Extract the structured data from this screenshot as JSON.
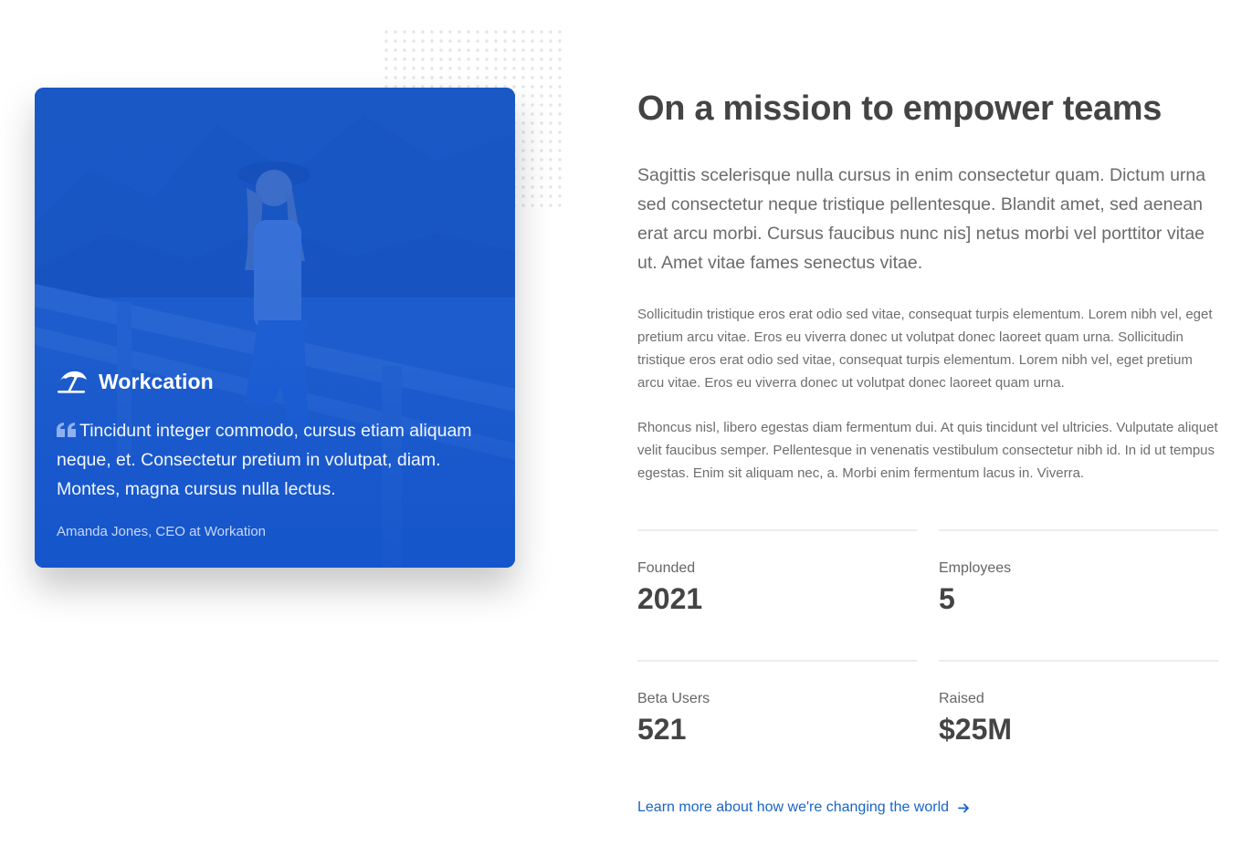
{
  "colors": {
    "accent": "#1a64c8",
    "card_overlay": "#155ad6",
    "heading": "#444444",
    "body_text": "#6b6b6b"
  },
  "card": {
    "brand_icon": "beach-umbrella-icon",
    "brand_name": "Workcation",
    "quote_icon": "quote-icon",
    "quote": "Tincidunt integer commodo, cursus etiam aliquam neque, et. Consectetur pretium in volutpat, diam. Montes, magna cursus nulla lectus.",
    "author": "Amanda Jones, CEO at Workation"
  },
  "content": {
    "heading": "On a mission to empower teams",
    "lead": "Sagittis scelerisque nulla cursus in enim consectetur quam. Dictum urna sed consectetur neque tristique pellentesque. Blandit amet, sed aenean erat arcu morbi. Cursus faucibus nunc nis] netus morbi vel porttitor vitae ut. Amet vitae fames senectus vitae.",
    "paragraph_1": "Sollicitudin tristique eros erat odio sed vitae, consequat turpis elementum. Lorem nibh vel, eget pretium arcu vitae. Eros eu viverra donec ut volutpat donec laoreet quam urna. Sollicitudin tristique eros erat odio sed vitae, consequat turpis elementum. Lorem nibh vel, eget pretium arcu vitae. Eros eu viverra donec ut volutpat donec laoreet quam urna.",
    "paragraph_2": "Rhoncus nisl, libero egestas diam fermentum dui. At quis tincidunt vel ultricies. Vulputate aliquet velit faucibus semper. Pellentesque in venenatis vestibulum consectetur nibh id. In id ut tempus egestas. Enim sit aliquam nec, a. Morbi enim fermentum lacus in. Viverra."
  },
  "stats": [
    {
      "label": "Founded",
      "value": "2021"
    },
    {
      "label": "Employees",
      "value": "5"
    },
    {
      "label": "Beta Users",
      "value": "521"
    },
    {
      "label": "Raised",
      "value": "$25M"
    }
  ],
  "link": {
    "label": "Learn more about how we're changing the world",
    "icon": "arrow-right-icon"
  }
}
